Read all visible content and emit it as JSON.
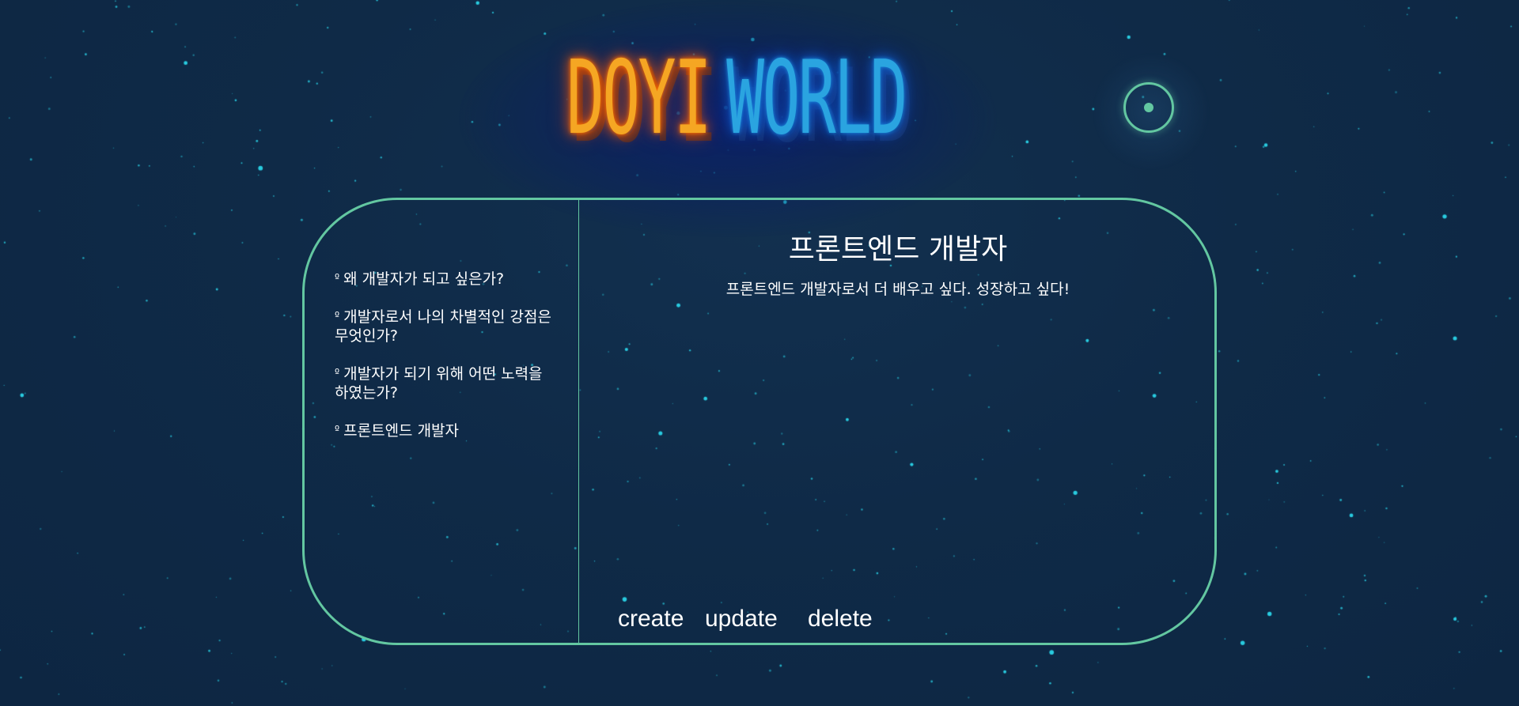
{
  "header": {
    "title_part1": "DOYI",
    "title_part2": "WORLD"
  },
  "nav": {
    "bullet": "º",
    "items": [
      {
        "label": "왜 개발자가 되고 싶은가?"
      },
      {
        "label": "개발자로서 나의 차별적인 강점은 무엇인가?"
      },
      {
        "label": "개발자가 되기 위해 어떤 노력을 하였는가?"
      },
      {
        "label": "프론트엔드 개발자"
      }
    ]
  },
  "article": {
    "title": "프론트엔드 개발자",
    "body": "프론트엔드 개발자로서 더 배우고 싶다. 성장하고 싶다!"
  },
  "controls": {
    "create_label": "create",
    "update_label": "update",
    "delete_label": "delete"
  },
  "colors": {
    "background": "#0f2a47",
    "accent": "#63c7a1",
    "title_orange": "#f5a623",
    "title_blue": "#2aa4e0",
    "star": "#2ad4e8"
  },
  "icons": {
    "theme_toggle": "moon-icon"
  }
}
